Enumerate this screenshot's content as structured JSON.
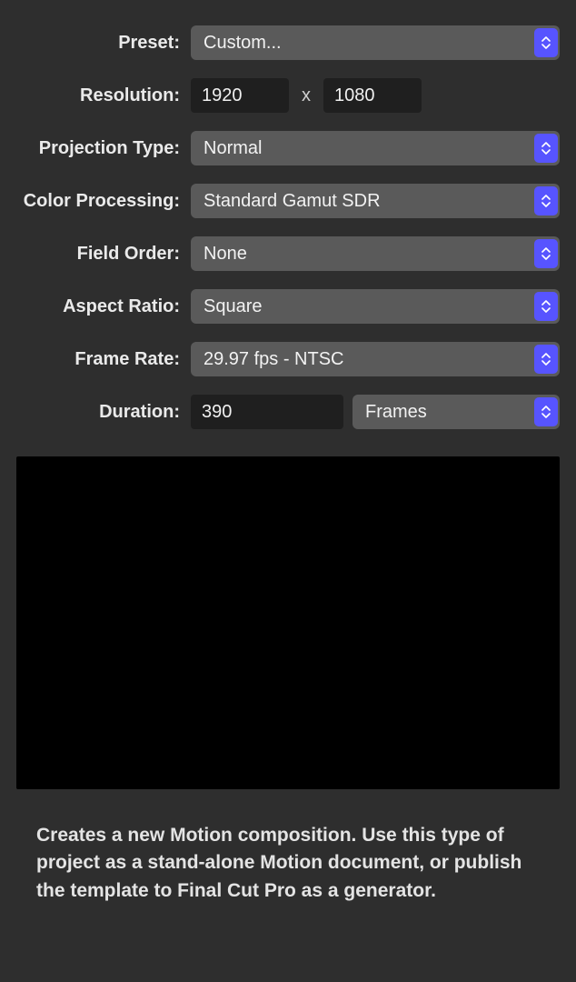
{
  "labels": {
    "preset": "Preset:",
    "resolution": "Resolution:",
    "projection": "Projection Type:",
    "color": "Color Processing:",
    "field": "Field Order:",
    "aspect": "Aspect Ratio:",
    "framerate": "Frame Rate:",
    "duration": "Duration:"
  },
  "values": {
    "preset": "Custom...",
    "res_w": "1920",
    "res_sep": "x",
    "res_h": "1080",
    "projection": "Normal",
    "color": "Standard Gamut SDR",
    "field": "None",
    "aspect": "Square",
    "framerate": "29.97 fps - NTSC",
    "duration": "390",
    "duration_unit": "Frames"
  },
  "description": "Creates a new Motion composition. Use this type of project as a stand-alone Motion document, or publish the template to Final Cut Pro as a generator."
}
